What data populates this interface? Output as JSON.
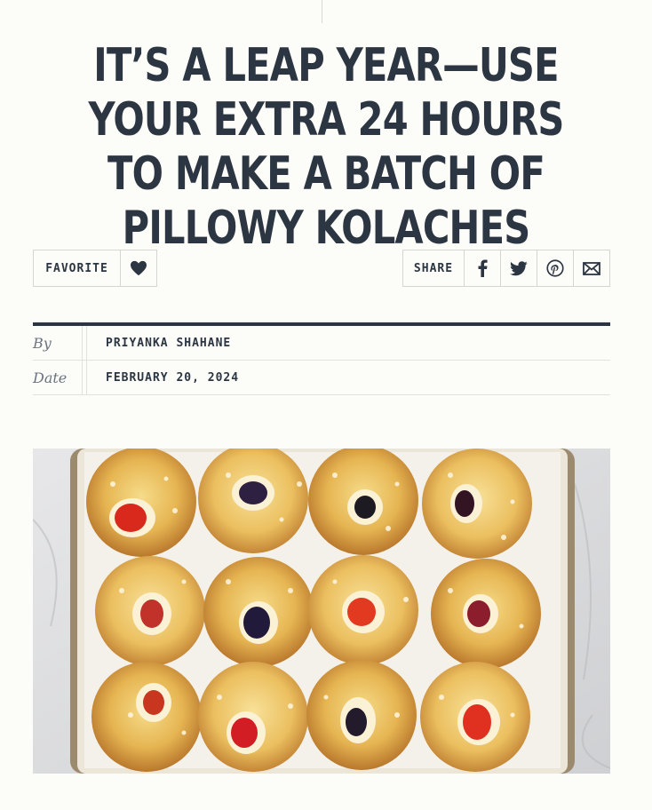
{
  "article": {
    "title": "IT’S A LEAP YEAR—USE YOUR EXTRA 24 HOURS TO MAKE A BATCH OF PILLOWY KOLACHES"
  },
  "actions": {
    "favorite_label": "FAVORITE",
    "share_label": "SHARE",
    "favorite_icon": "heart-icon",
    "share_icons": [
      "facebook-icon",
      "twitter-icon",
      "pinterest-icon",
      "email-icon"
    ]
  },
  "meta": {
    "by_label": "By",
    "author": "PRIYANKA SHAHANE",
    "date_label": "Date",
    "date": "FEBRUARY 20, 2024"
  },
  "colors": {
    "text": "#2c3542",
    "background": "#fcfcf8",
    "border": "#d6d6d0"
  }
}
